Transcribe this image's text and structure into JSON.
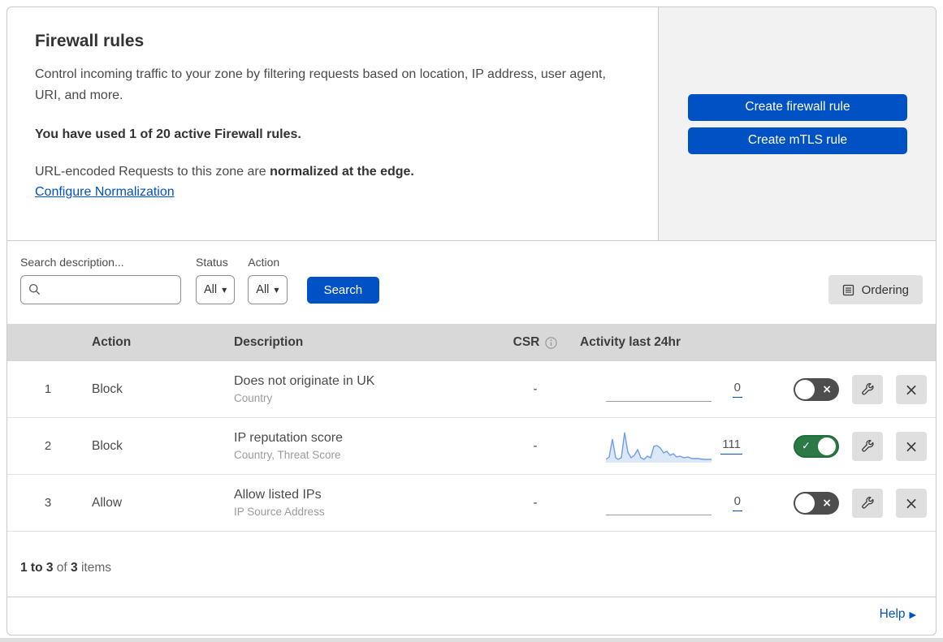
{
  "header": {
    "title": "Firewall rules",
    "description": "Control incoming traffic to your zone by filtering requests based on location, IP address, user agent, URI, and more.",
    "usage_note": "You have used 1 of 20 active Firewall rules.",
    "normalization_text": "URL-encoded Requests to this zone are ",
    "normalization_bold": "normalized at the edge.",
    "normalization_link": "Configure Normalization",
    "create_firewall_button": "Create firewall rule",
    "create_mtls_button": "Create mTLS rule"
  },
  "filters": {
    "search_label": "Search description...",
    "status_label": "Status",
    "status_value": "All",
    "action_label": "Action",
    "action_value": "All",
    "search_button": "Search",
    "ordering_button": "Ordering"
  },
  "table": {
    "columns": {
      "action": "Action",
      "description": "Description",
      "csr": "CSR",
      "activity": "Activity last 24hr"
    },
    "rows": [
      {
        "index": "1",
        "action": "Block",
        "description": "Does not originate in UK",
        "criteria": "Country",
        "csr": "-",
        "activity_count": "0",
        "enabled": false
      },
      {
        "index": "2",
        "action": "Block",
        "description": "IP reputation score",
        "criteria": "Country, Threat Score",
        "csr": "-",
        "activity_count": "111",
        "enabled": true,
        "activity_sparkline": "0,36 4,33 8,11 12,34 15,36 19,34 23,3 27,27 31,34 35,31 39,24 43,34 47,36 51,32 55,34 59,20 63,19 67,22 71,28 75,26 79,31 83,29 87,33 91,32 96,34 101,33 106,35 113,35 121,36 130,36"
      },
      {
        "index": "3",
        "action": "Allow",
        "description": "Allow listed IPs",
        "criteria": "IP Source Address",
        "csr": "-",
        "activity_count": "0",
        "enabled": false
      }
    ]
  },
  "footer": {
    "range": "1 to 3",
    "of": "of",
    "total": "3",
    "items_label": "items",
    "help_label": "Help"
  },
  "colors": {
    "primary_blue": "#0051c3",
    "toggle_on_green": "#2b7a46",
    "toggle_off_gray": "#4d4d4d",
    "sparkline_blue": "#6d9ee9",
    "panel_gray": "#f2f2f2",
    "table_header_gray": "#d8d8d8"
  }
}
